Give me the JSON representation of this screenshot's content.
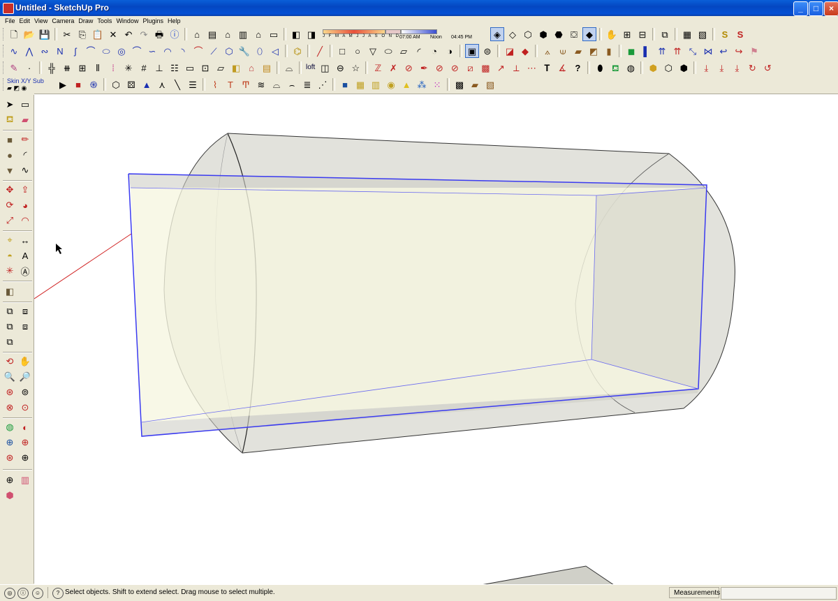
{
  "window": {
    "title": "Untitled - SketchUp Pro",
    "controls": [
      "_",
      "□",
      "×"
    ]
  },
  "menu": [
    "File",
    "Edit",
    "View",
    "Camera",
    "Draw",
    "Tools",
    "Window",
    "Plugins",
    "Help"
  ],
  "shadow": {
    "months": "J F M A M J J A S O N D",
    "time_start": "07:00 AM",
    "time_noon": "Noon",
    "time_end": "04:45 PM"
  },
  "toolbar": {
    "loft_label": "loft",
    "skin_label": "Skin",
    "xy_label": "X/Y",
    "sub_label": "Sub"
  },
  "status": {
    "hint": "Select objects. Shift to extend select. Drag mouse to select multiple.",
    "measurements_label": "Measurements",
    "measurements_value": ""
  },
  "colors": {
    "selection_blue": "#3a3af0",
    "axis_red": "#d02020",
    "cylinder_fill": "#d8d8d0",
    "plane_fill": "#f6f6e0"
  }
}
